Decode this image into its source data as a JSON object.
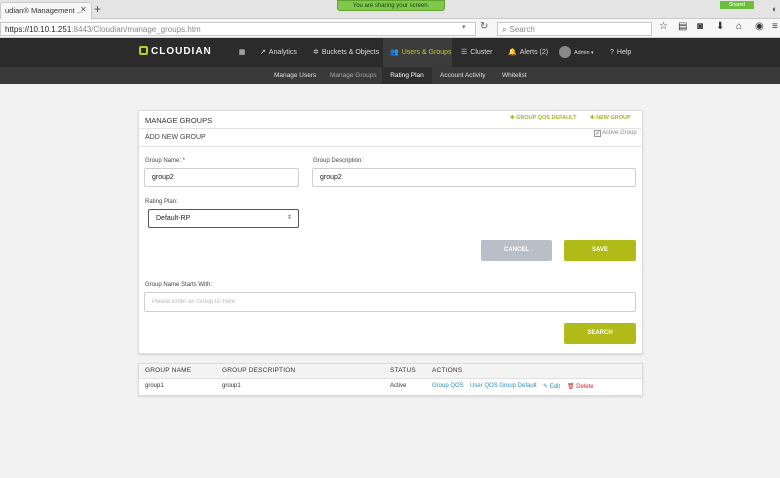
{
  "browser": {
    "tab_title": "udian® Management ...",
    "url_host": "https://10.10.1.251",
    "url_rest": ":8443/Cloudian/manage_groups.htm",
    "search_placeholder": "Search",
    "sharing_banner": "You are sharing your screen.",
    "shared_badge": "Shared"
  },
  "app": {
    "logo_text": "CLOUDIAN",
    "brand_color": "#c0cc2a",
    "nav": [
      {
        "label": "",
        "icon": "dashboard-grid-icon"
      },
      {
        "label": "Analytics",
        "icon": "analytics-icon"
      },
      {
        "label": "Buckets & Objects",
        "icon": "gear-icon"
      },
      {
        "label": "Users & Groups",
        "icon": "users-icon",
        "active": true
      },
      {
        "label": "Cluster",
        "icon": "cluster-icon"
      },
      {
        "label": "Alerts (2)",
        "icon": "bell-icon"
      },
      {
        "label": "Admin",
        "icon": "avatar-icon"
      },
      {
        "label": "Help",
        "icon": "help-icon"
      }
    ],
    "subnav": [
      "Manage Users",
      "Manage Groups",
      "Rating Plan",
      "Account Activity",
      "Whitelist"
    ]
  },
  "panel": {
    "title": "MANAGE GROUPS",
    "group_qos_default": "GROUP QOS DEFAULT",
    "new_group": "NEW GROUP",
    "subtitle": "ADD NEW GROUP",
    "active_group_label": "Active Group",
    "group_name_label": "Group Name: *",
    "group_name_value": "group2",
    "group_description_label": "Group Description:",
    "group_description_value": "group2",
    "rating_plan_label": "Rating Plan:",
    "rating_plan_value": "Default-RP",
    "cancel_label": "CANCEL",
    "save_label": "SAVE",
    "starts_with_label": "Group Name Starts With:",
    "starts_with_placeholder": "Please Enter an Group ID Here",
    "search_label": "SEARCH"
  },
  "table": {
    "headers": [
      "GROUP NAME",
      "GROUP DESCRIPTION",
      "STATUS",
      "ACTIONS"
    ],
    "rows": [
      {
        "name": "group1",
        "description": "group1",
        "status": "Active",
        "actions": {
          "qos": "Group QOS",
          "user_qos": "User QOS Group Default",
          "edit": "Edit",
          "delete": "Delete"
        }
      }
    ]
  }
}
